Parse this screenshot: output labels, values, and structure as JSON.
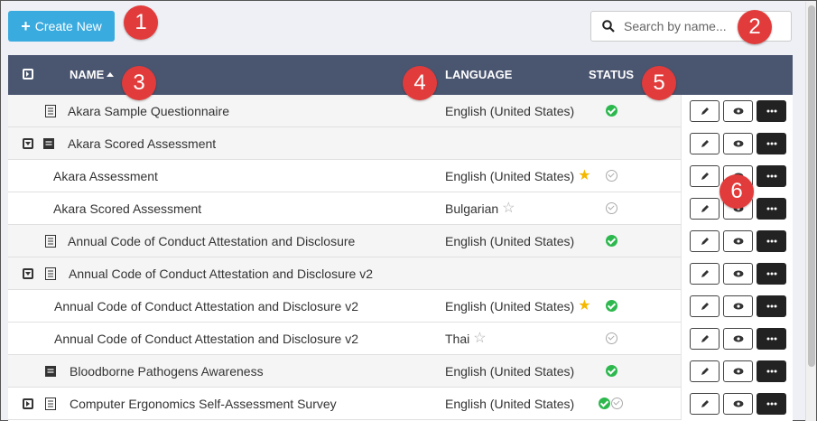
{
  "toolbar": {
    "create_label": "Create New"
  },
  "search": {
    "placeholder": "Search by name..."
  },
  "columns": {
    "name": "NAME",
    "language": "LANGUAGE",
    "status": "STATUS"
  },
  "rows": [
    {
      "name": "Akara Sample Questionnaire",
      "language": "English (United States)",
      "star": "none",
      "status": [
        "published"
      ]
    },
    {
      "name": "Akara Scored Assessment",
      "language": "",
      "star": "none",
      "status": []
    },
    {
      "name": "Akara Assessment",
      "language": "English (United States)",
      "star": "filled",
      "status": [
        "unpublished"
      ]
    },
    {
      "name": "Akara Scored Assessment",
      "language": "Bulgarian",
      "star": "empty",
      "status": [
        "unpublished"
      ]
    },
    {
      "name": "Annual Code of Conduct Attestation and Disclosure",
      "language": "English (United States)",
      "star": "none",
      "status": [
        "published"
      ]
    },
    {
      "name": "Annual Code of Conduct Attestation and Disclosure v2",
      "language": "",
      "star": "none",
      "status": []
    },
    {
      "name": "Annual Code of Conduct Attestation and Disclosure v2",
      "language": "English (United States)",
      "star": "filled",
      "status": [
        "published"
      ]
    },
    {
      "name": "Annual Code of Conduct Attestation and Disclosure v2",
      "language": "Thai",
      "star": "empty",
      "status": [
        "unpublished"
      ]
    },
    {
      "name": "Bloodborne Pathogens Awareness",
      "language": "English (United States)",
      "star": "none",
      "status": [
        "published"
      ]
    },
    {
      "name": "Computer Ergonomics Self-Assessment Survey",
      "language": "English (United States)",
      "star": "none",
      "status": [
        "published",
        "unpublished"
      ]
    }
  ],
  "annotations": [
    "1",
    "2",
    "3",
    "4",
    "5",
    "6"
  ],
  "colors": {
    "header_bg": "#4a5570",
    "create_button": "#3aabdf",
    "badge": "#e23b3b",
    "published": "#2db84e",
    "star": "#f5b800"
  }
}
